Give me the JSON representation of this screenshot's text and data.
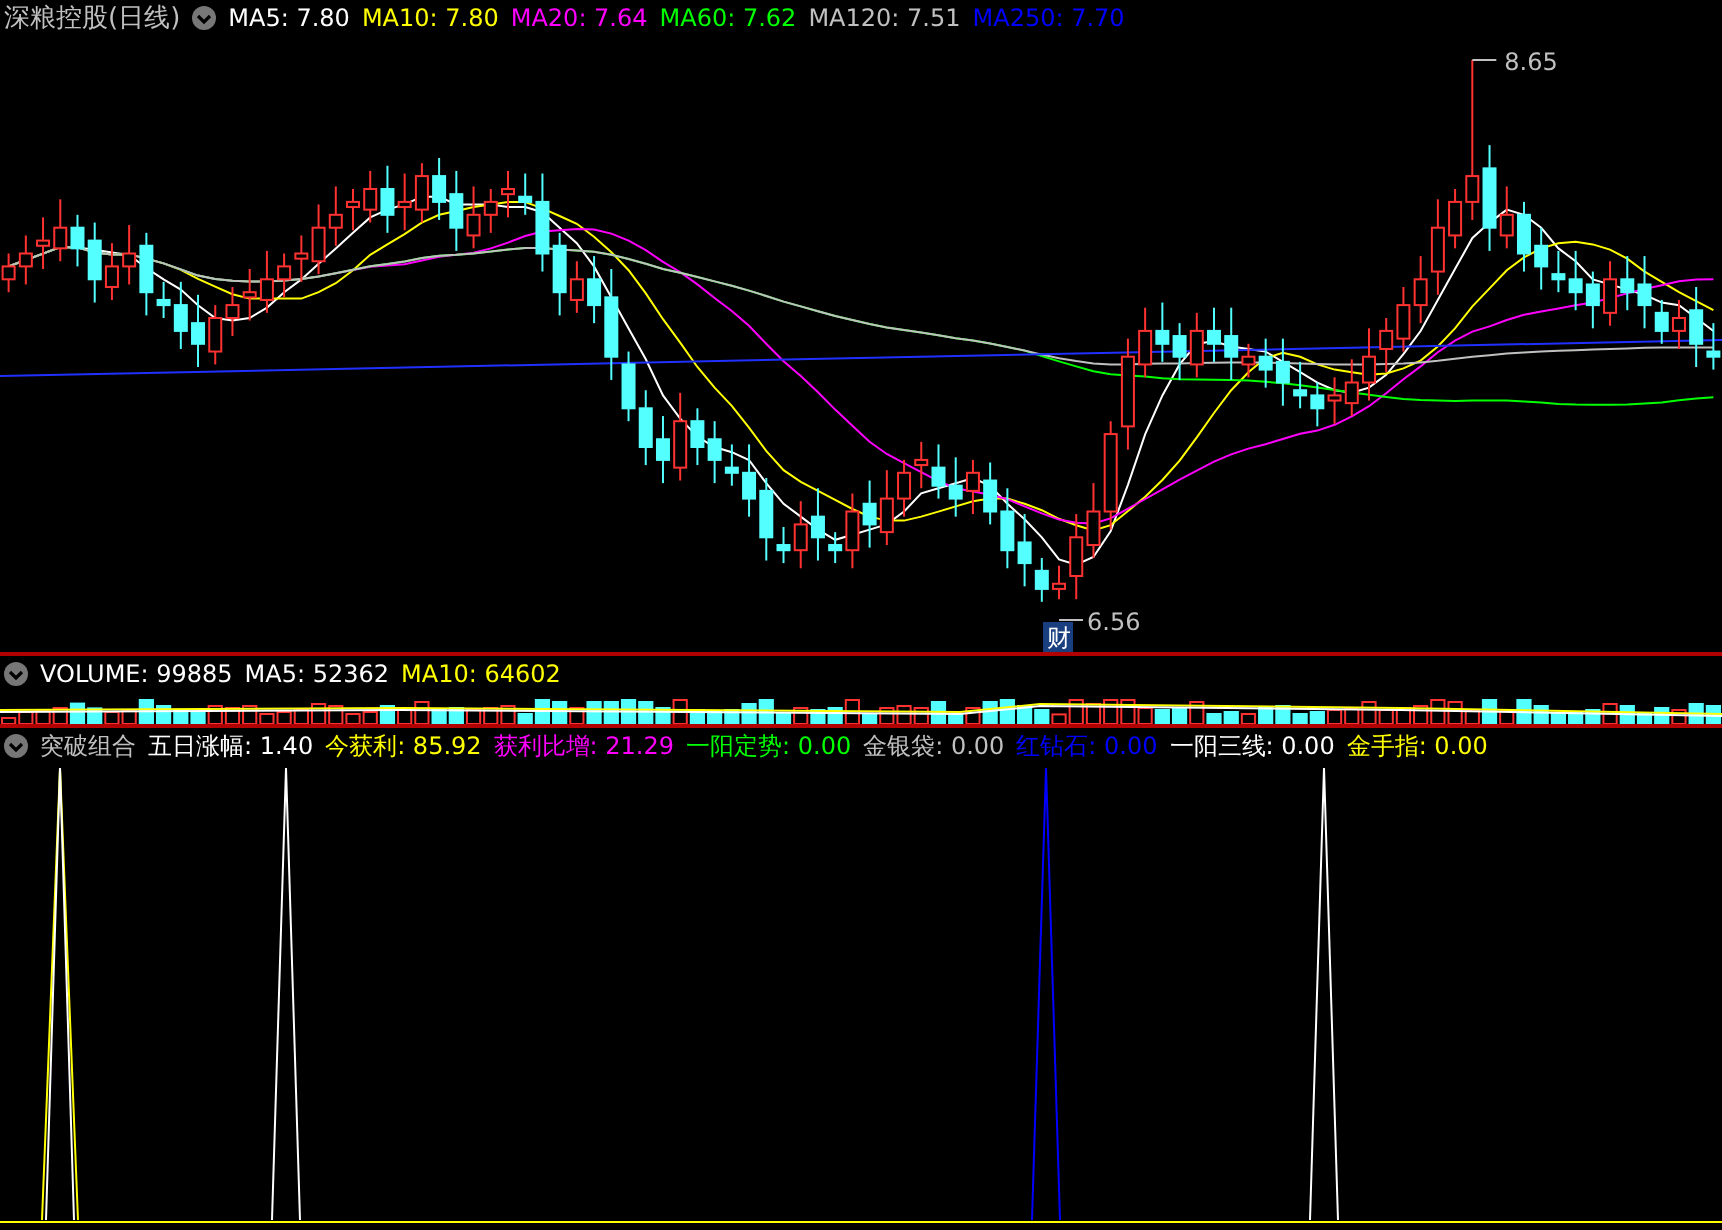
{
  "chart_title": "深粮控股(日线)",
  "price_legend": [
    {
      "label": "MA5: 7.80",
      "color": "#ffffff"
    },
    {
      "label": "MA10: 7.80",
      "color": "#ffff00"
    },
    {
      "label": "MA20: 7.64",
      "color": "#ff00ff"
    },
    {
      "label": "MA60: 7.62",
      "color": "#00ff00"
    },
    {
      "label": "MA120: 7.51",
      "color": "#c0c0c0"
    },
    {
      "label": "MA250: 7.70",
      "color": "#0000ff"
    }
  ],
  "high_label": "8.65",
  "low_label": "6.56",
  "event_badge": "财",
  "volume_legend": [
    {
      "label": "VOLUME: 99885",
      "color": "#ffffff"
    },
    {
      "label": "MA5: 52362",
      "color": "#ffffff"
    },
    {
      "label": "MA10: 64602",
      "color": "#ffff00"
    }
  ],
  "indicator_legend": [
    {
      "label": "突破组合",
      "color": "#c0c0c0"
    },
    {
      "label": "五日涨幅: 1.40",
      "color": "#ffffff"
    },
    {
      "label": "今获利: 85.92",
      "color": "#ffff00"
    },
    {
      "label": "获利比增: 21.29",
      "color": "#ff00ff"
    },
    {
      "label": "一阳定势: 0.00",
      "color": "#00ff00"
    },
    {
      "label": "金银袋: 0.00",
      "color": "#c0c0c0"
    },
    {
      "label": "红钻石: 0.00",
      "color": "#0000ff"
    },
    {
      "label": "一阳三线: 0.00",
      "color": "#ffffff"
    },
    {
      "label": "金手指: 0.00",
      "color": "#ffff00"
    }
  ]
}
